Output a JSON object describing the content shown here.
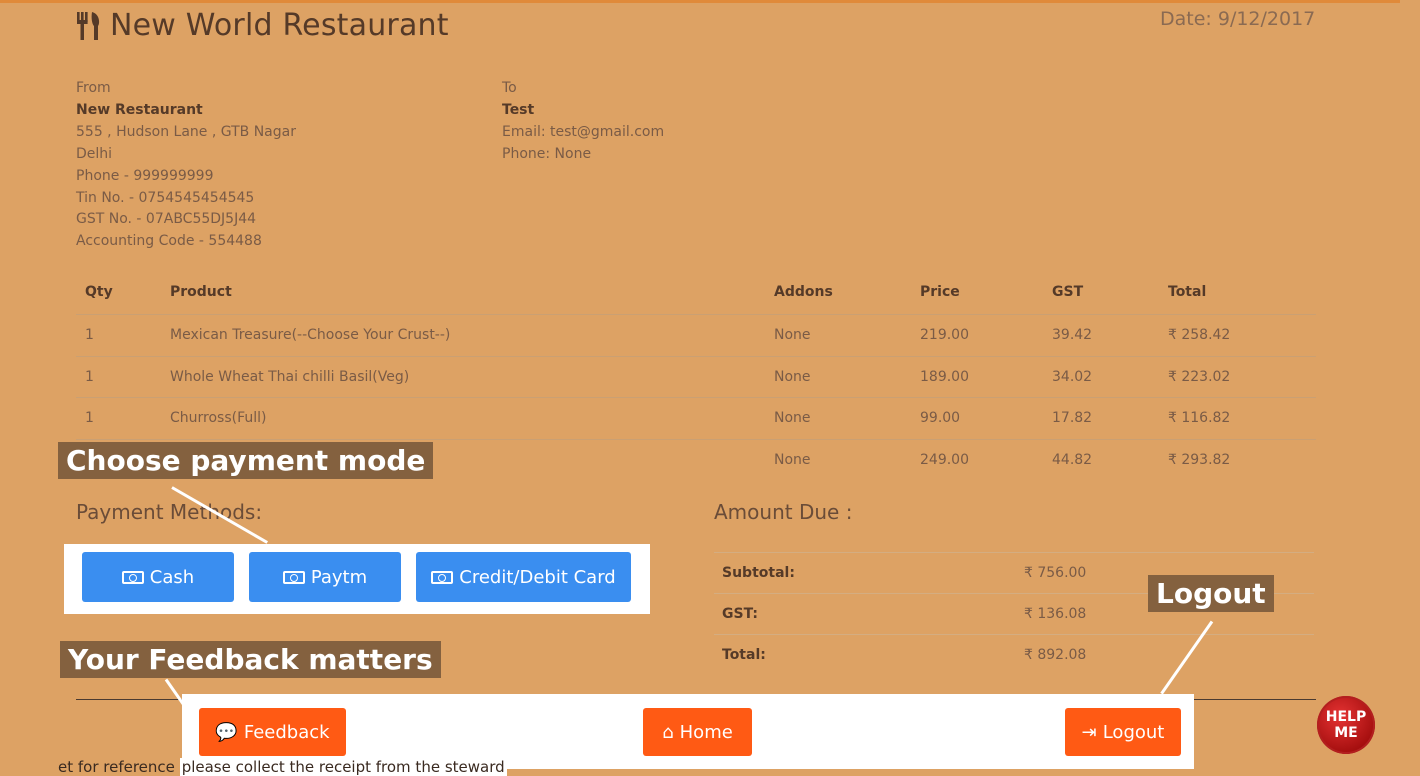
{
  "header": {
    "restaurant_name": "New World Restaurant",
    "date": "Date: 9/12/2017",
    "icon": "cutlery-icon"
  },
  "from": {
    "label": "From",
    "name": "New Restaurant",
    "lines": [
      "555 , Hudson Lane , GTB Nagar",
      "Delhi",
      "Phone - 999999999",
      "Tin No. - 0754545454545",
      "GST No. - 07ABC55DJ5J44",
      "Accounting Code - 554488"
    ]
  },
  "to": {
    "label": "To",
    "name": "Test",
    "lines": [
      "Email: test@gmail.com",
      "Phone: None"
    ]
  },
  "order_table": {
    "headers": [
      "Qty",
      "Product",
      "Addons",
      "Price",
      "GST",
      "Total"
    ],
    "rows": [
      [
        "1",
        "Mexican Treasure(--Choose Your Crust--)",
        "None",
        "219.00",
        "39.42",
        "₹ 258.42"
      ],
      [
        "1",
        "Whole Wheat Thai chilli Basil(Veg)",
        "None",
        "189.00",
        "34.02",
        "₹ 223.02"
      ],
      [
        "1",
        "Churross(Full)",
        "None",
        "99.00",
        "17.82",
        "₹ 116.82"
      ],
      [
        "",
        "",
        "None",
        "249.00",
        "44.82",
        "₹ 293.82"
      ]
    ]
  },
  "payment": {
    "title": "Payment Methods:",
    "buttons": [
      "Cash",
      "Paytm",
      "Credit/Debit Card"
    ],
    "icon": "money-icon"
  },
  "amount_due": {
    "title": "Amount Due :",
    "rows": [
      {
        "label": "Subtotal:",
        "value": "₹ 756.00"
      },
      {
        "label": "GST:",
        "value": "₹ 136.08"
      },
      {
        "label": "Total:",
        "value": "₹ 892.08"
      }
    ]
  },
  "callouts": {
    "payment_mode": "Choose payment mode",
    "feedback": "Your Feedback matters",
    "logout": "Logout"
  },
  "footer": {
    "feedback": "Feedback",
    "home": "Home",
    "logout": "Logout",
    "bottom_text_left": "et for reference",
    "bottom_text_right": "please collect the receipt from the steward"
  },
  "help": {
    "line1": "HELP",
    "line2": "ME"
  },
  "colors": {
    "background": "#dda264",
    "payment_button": "#3a8ef0",
    "footer_button": "#ff5a14",
    "callout": "#84613f"
  }
}
